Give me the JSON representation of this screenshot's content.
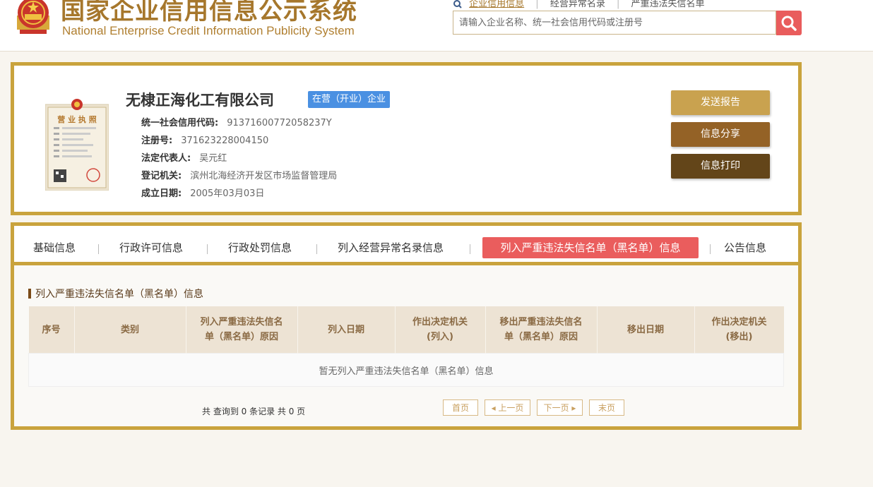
{
  "header": {
    "title_cn": "国家企业信用信息公示系统",
    "title_en": "National Enterprise Credit Information Publicity System",
    "nav": [
      "企业信用信息",
      "经营异常名录",
      "严重违法失信名单"
    ],
    "search_placeholder": "请输入企业名称、统一社会信用代码或注册号"
  },
  "company": {
    "name": "无棣正海化工有限公司",
    "status": "在营（开业）企业",
    "fields": [
      {
        "label": "统一社会信用代码:",
        "value": "91371600772058237Y"
      },
      {
        "label": "注册号:",
        "value": "371623228004150"
      },
      {
        "label": "法定代表人:",
        "value": "吴元红"
      },
      {
        "label": "登记机关:",
        "value": "滨州北海经济开发区市场监督管理局"
      },
      {
        "label": "成立日期:",
        "value": "2005年03月03日"
      }
    ],
    "license_text": "营 业 执 照",
    "actions": [
      {
        "label": "发送报告",
        "color": "#c9a24f"
      },
      {
        "label": "信息分享",
        "color": "#946226"
      },
      {
        "label": "信息打印",
        "color": "#634519"
      }
    ]
  },
  "tabs": [
    "基础信息",
    "行政许可信息",
    "行政处罚信息",
    "列入经营异常名录信息",
    "列入严重违法失信名单（黑名单）信息",
    "公告信息"
  ],
  "section": {
    "title": "列入严重违法失信名单（黑名单）信息",
    "columns": [
      [
        "序号"
      ],
      [
        "类别"
      ],
      [
        "列入严重违法失信名",
        "单（黑名单）原因"
      ],
      [
        "列入日期"
      ],
      [
        "作出决定机关",
        "(列入)"
      ],
      [
        "移出严重违法失信名",
        "单（黑名单）原因"
      ],
      [
        "移出日期"
      ],
      [
        "作出决定机关",
        "(移出)"
      ]
    ],
    "empty_text": "暂无列入严重违法失信名单（黑名单）信息",
    "pager_info": "共 查询到 0 条记录 共 0 页",
    "pager": [
      "首页",
      "◂ 上一页",
      "下一页 ▸",
      "末页"
    ]
  },
  "colors": {
    "gold": "#c9a33d",
    "accent_red": "#ea5d5d",
    "badge_blue": "#4a90e2"
  }
}
